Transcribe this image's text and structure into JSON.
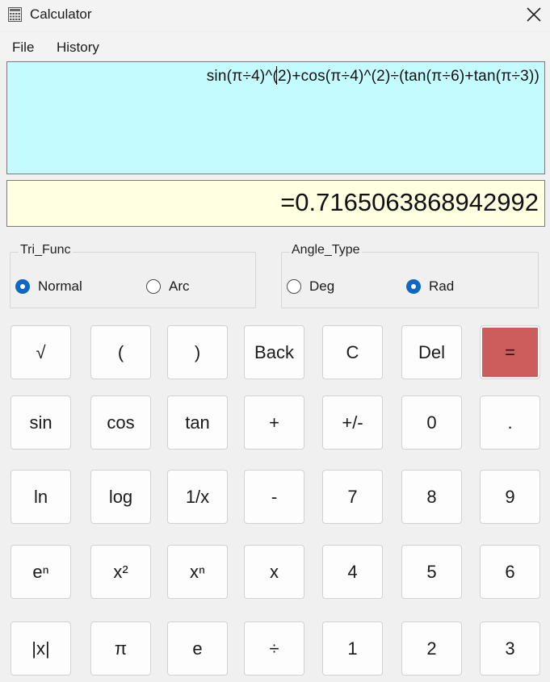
{
  "window": {
    "title": "Calculator",
    "icon": "calculator-icon",
    "close_icon": "close-icon"
  },
  "menu": [
    {
      "label": "File"
    },
    {
      "label": "History"
    }
  ],
  "expression": "sin(π÷4)^(2)+cos(π÷4)^(2)÷(tan(π÷6)+tan(π÷3))",
  "result": "=0.7165063868942992",
  "colors": {
    "expression_bg": "#c3fbff",
    "result_bg": "#ffffe1",
    "equals_bg": "#cd5c5c",
    "radio_accent": "#0f68c4"
  },
  "tri_func": {
    "label": "Tri_Func",
    "options": [
      {
        "label": "Normal",
        "checked": true
      },
      {
        "label": "Arc",
        "checked": false
      }
    ]
  },
  "angle_type": {
    "label": "Angle_Type",
    "options": [
      {
        "label": "Deg",
        "checked": false
      },
      {
        "label": "Rad",
        "checked": true
      }
    ]
  },
  "buttons": [
    [
      "√",
      "(",
      ")",
      "Back",
      "C",
      "Del",
      "="
    ],
    [
      "sin",
      "cos",
      "tan",
      "+",
      "+/-",
      "0",
      "."
    ],
    [
      "ln",
      "log",
      "1/x",
      "-",
      "7",
      "8",
      "9"
    ],
    [
      "eⁿ",
      "x²",
      "xⁿ",
      "x",
      "4",
      "5",
      "6"
    ],
    [
      "|x|",
      "π",
      "e",
      "÷",
      "1",
      "2",
      "3"
    ]
  ]
}
